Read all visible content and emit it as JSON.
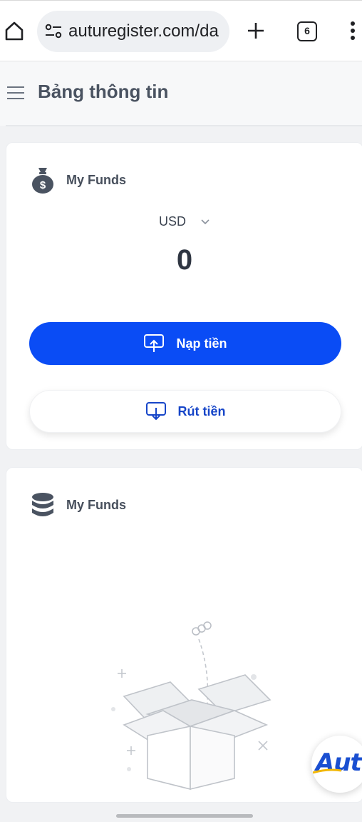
{
  "browser": {
    "url": "auturegister.com/da",
    "tab_count": "6",
    "icons": [
      "home-icon",
      "site-settings-icon",
      "new-tab-icon",
      "tab-switcher-icon",
      "more-vert-icon"
    ]
  },
  "header": {
    "title": "Bảng thông tin",
    "menu_icon": "hamburger-icon"
  },
  "funds_card": {
    "label": "My Funds",
    "icon": "money-bag-icon",
    "currency": "USD",
    "balance": "0",
    "deposit_label": "Nạp tiền",
    "withdraw_label": "Rút tiền"
  },
  "holdings_card": {
    "label": "My Funds",
    "icon": "coins-stack-icon",
    "empty_state_icon": "empty-box-icon"
  },
  "brand_badge": {
    "text": "Autu"
  },
  "colors": {
    "primary": "#0a4cf5",
    "primary_text": "#1645c8",
    "title": "#4a5361"
  }
}
